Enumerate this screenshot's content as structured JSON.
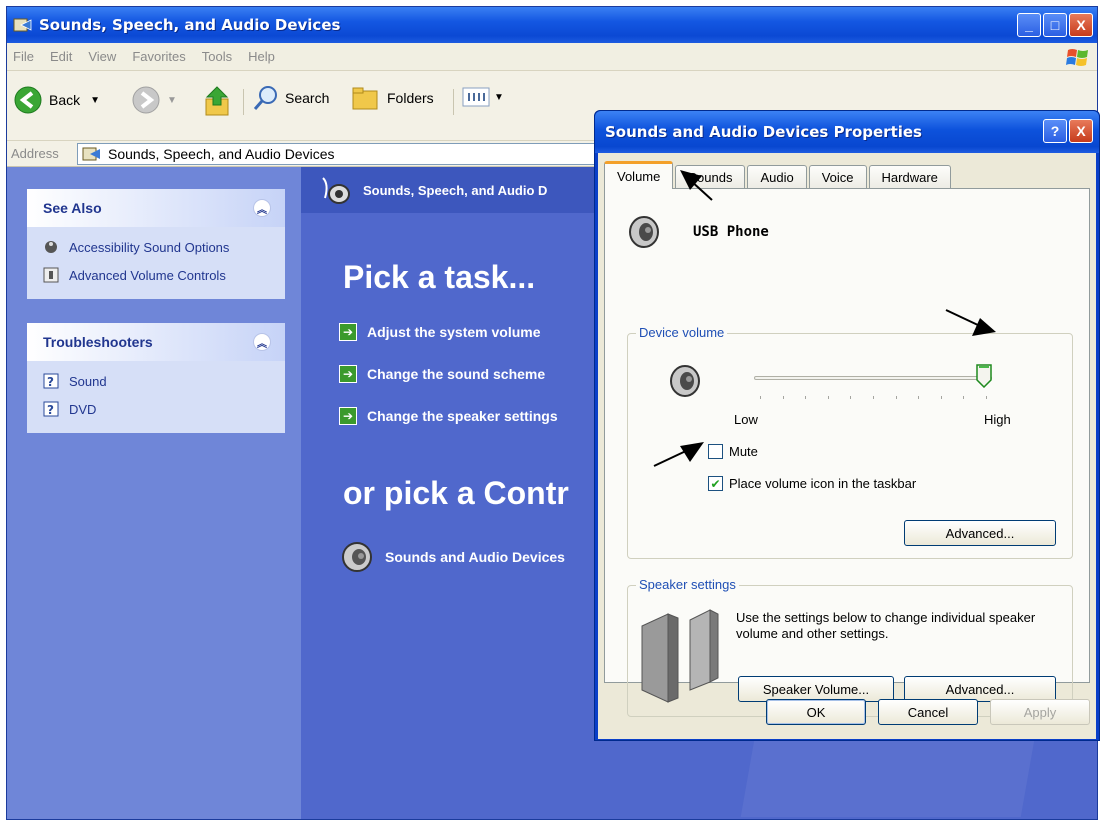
{
  "window": {
    "title": "Sounds, Speech, and Audio Devices",
    "minimize": "_",
    "maximize": "□",
    "close": "X"
  },
  "menu": [
    "File",
    "Edit",
    "View",
    "Favorites",
    "Tools",
    "Help"
  ],
  "toolbar": {
    "back": "Back",
    "search": "Search",
    "folders": "Folders"
  },
  "address": {
    "label": "Address",
    "value": "Sounds, Speech, and Audio Devices"
  },
  "see_also": {
    "title": "See Also",
    "items": [
      "Accessibility Sound Options",
      "Advanced Volume Controls"
    ]
  },
  "troubleshooters": {
    "title": "Troubleshooters",
    "items": [
      "Sound",
      "DVD"
    ]
  },
  "content": {
    "header": "Sounds, Speech, and Audio D",
    "pick_task": "Pick a task...",
    "tasks": [
      "Adjust the system volume",
      "Change the sound scheme",
      "Change the speaker settings"
    ],
    "pick_control": "or pick a Contr",
    "controls": [
      "Sounds and Audio Devices"
    ]
  },
  "dialog": {
    "title": "Sounds and Audio Devices Properties",
    "help": "?",
    "close": "X",
    "tabs": [
      "Volume",
      "Sounds",
      "Audio",
      "Voice",
      "Hardware"
    ],
    "active_tab": "Volume",
    "device_name": "USB Phone",
    "device_volume": {
      "legend": "Device volume",
      "low": "Low",
      "high": "High",
      "level_percent": 100,
      "mute_label": "Mute",
      "mute_checked": false,
      "taskbar_label": "Place volume icon in the taskbar",
      "taskbar_checked": true,
      "advanced": "Advanced..."
    },
    "speaker_settings": {
      "legend": "Speaker settings",
      "description": "Use the settings below to change individual speaker volume and other settings.",
      "speaker_volume": "Speaker Volume...",
      "advanced": "Advanced..."
    },
    "buttons": {
      "ok": "OK",
      "cancel": "Cancel",
      "apply": "Apply"
    }
  },
  "colors": {
    "xp_blue": "#0a3fc8",
    "task_pane": "#6f86d8",
    "content_bg": "#5068cc",
    "dialog_face": "#ece9d8",
    "tab_highlight": "#f3a02a"
  }
}
